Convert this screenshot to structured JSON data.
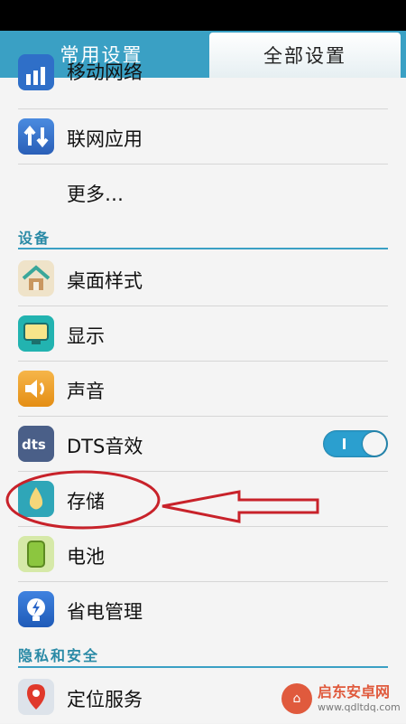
{
  "tabs": {
    "common": "常用设置",
    "all": "全部设置"
  },
  "rows_top": [
    {
      "label": "移动网络",
      "icon": "signal-bars-icon"
    },
    {
      "label": "联网应用",
      "icon": "transfer-arrows-icon"
    },
    {
      "label": "更多…"
    }
  ],
  "sections": {
    "device": "设备",
    "privacy": "隐私和安全"
  },
  "device_items": [
    {
      "label": "桌面样式",
      "icon": "home-style-icon"
    },
    {
      "label": "显示",
      "icon": "display-icon"
    },
    {
      "label": "声音",
      "icon": "speaker-icon"
    },
    {
      "label": "DTS音效",
      "icon": "dts-icon",
      "toggle": "on"
    },
    {
      "label": "存储",
      "icon": "storage-drop-icon"
    },
    {
      "label": "电池",
      "icon": "battery-icon"
    },
    {
      "label": "省电管理",
      "icon": "power-saving-icon"
    }
  ],
  "privacy_items": [
    {
      "label": "定位服务",
      "icon": "location-pin-icon"
    }
  ],
  "watermark": {
    "title": "启东安卓网",
    "url": "www.qdltdq.com"
  },
  "colors": {
    "accent": "#3aa0c4",
    "annotation": "#c8222a"
  }
}
